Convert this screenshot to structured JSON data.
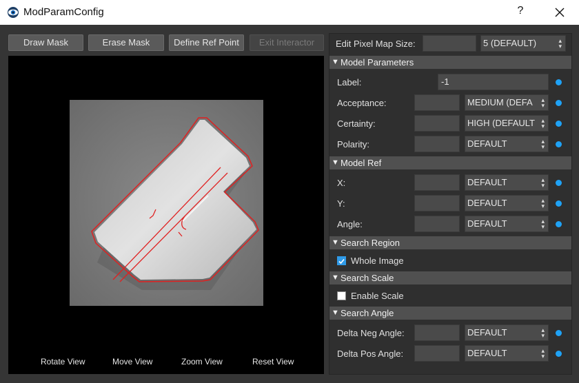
{
  "window": {
    "title": "ModParamConfig",
    "help_label": "?"
  },
  "toolbar": {
    "draw_mask": "Draw Mask",
    "erase_mask": "Erase Mask",
    "define_ref_point": "Define Ref Point",
    "exit_interactor": "Exit Interactor"
  },
  "viewer": {
    "rotate": "Rotate View",
    "move": "Move View",
    "zoom": "Zoom View",
    "reset": "Reset View"
  },
  "pixel_map": {
    "label": "Edit Pixel Map Size:",
    "value": "",
    "selected": "5 (DEFAULT)"
  },
  "model_parameters": {
    "title": "Model Parameters",
    "label": {
      "label": "Label:",
      "value": "-1"
    },
    "acceptance": {
      "label": "Acceptance:",
      "value": "",
      "selected": "MEDIUM (DEFA"
    },
    "certainty": {
      "label": "Certainty:",
      "value": "",
      "selected": "HIGH (DEFAULT"
    },
    "polarity": {
      "label": "Polarity:",
      "value": "",
      "selected": "DEFAULT"
    }
  },
  "model_ref": {
    "title": "Model Ref",
    "x": {
      "label": "X:",
      "value": "",
      "selected": "DEFAULT"
    },
    "y": {
      "label": "Y:",
      "value": "",
      "selected": "DEFAULT"
    },
    "angle": {
      "label": "Angle:",
      "value": "",
      "selected": "DEFAULT"
    }
  },
  "search_region": {
    "title": "Search Region",
    "whole_image": {
      "label": "Whole Image",
      "checked": true
    }
  },
  "search_scale": {
    "title": "Search Scale",
    "enable_scale": {
      "label": "Enable Scale",
      "checked": false
    }
  },
  "search_angle": {
    "title": "Search Angle",
    "delta_neg": {
      "label": "Delta Neg Angle:",
      "value": "",
      "selected": "DEFAULT"
    },
    "delta_pos": {
      "label": "Delta Pos Angle:",
      "value": "",
      "selected": "DEFAULT"
    }
  },
  "colors": {
    "accent": "#1fa2f5",
    "mask_outline": "#e02020"
  }
}
